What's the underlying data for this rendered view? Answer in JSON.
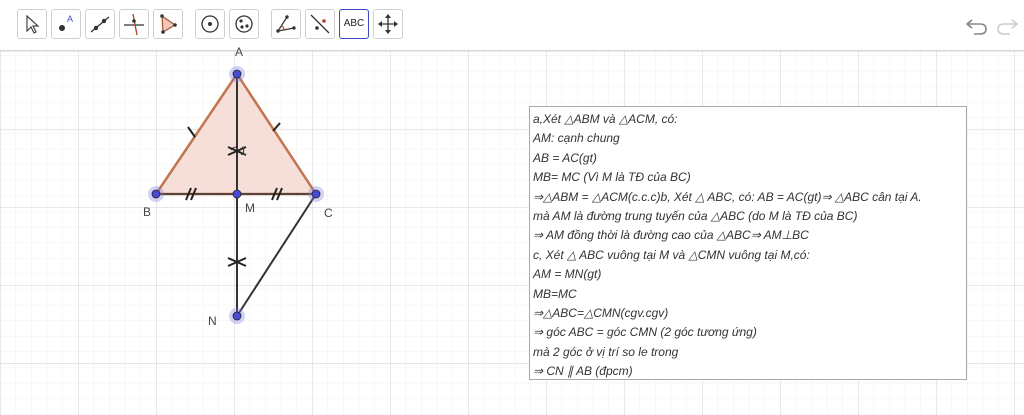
{
  "toolbar": {
    "tools": [
      {
        "name": "move",
        "icon": "cursor-arrow-icon"
      },
      {
        "name": "point",
        "icon": "point-icon",
        "label": "A"
      },
      {
        "name": "line",
        "icon": "line-icon"
      },
      {
        "name": "perpendicular",
        "icon": "perpendicular-line-icon"
      },
      {
        "name": "polygon",
        "icon": "polygon-icon"
      },
      {
        "name": "circle",
        "icon": "circle-center-icon"
      },
      {
        "name": "circle-three-points",
        "icon": "circle-three-points-icon"
      },
      {
        "name": "angle",
        "icon": "angle-icon"
      },
      {
        "name": "reflect",
        "icon": "reflect-icon"
      },
      {
        "name": "text",
        "icon": "text-icon",
        "label": "ABC"
      },
      {
        "name": "move-view",
        "icon": "move-graphics-icon"
      }
    ],
    "undo_icon": "undo-icon",
    "redo_icon": "redo-icon"
  },
  "geometry": {
    "points": {
      "A": "A",
      "B": "B",
      "C": "C",
      "M": "M",
      "N": "N"
    },
    "angle_label": "1",
    "colors": {
      "triangle_fill": "#f5dcd4",
      "triangle_stroke": "#c0754f",
      "point_fill": "#4a4ad6",
      "segment": "#333333"
    }
  },
  "text_lines": [
    "a,Xét △ABM và △ACM, có:",
    "  AM: cạnh chung",
    "  AB = AC(gt)",
    "    MB= MC (Vì M là TĐ của BC)",
    "⇒△ABM = △ACM(c.c.c)b, Xét △ ABC, có:    AB = AC(gt)⇒ △ABC cân tại A.",
    "mà AM là đường trung tuyến của △ABC (do M là TĐ của BC)",
    "⇒ AM đồng thời là đường cao của △ABC⇒ AM⊥BC",
    "c, Xét △ ABC vuông tại M và △CMN vuông tại M,có:",
    "  AM = MN(gt)",
    "  MB=MC",
    "⇒△ABC=△CMN(cgv.cgv)",
    "⇒ góc ABC = góc CMN (2 góc tương ứng)",
    "mà 2 góc ở vị trí so le trong",
    "⇒ CN ∥ AB (đpcm)"
  ]
}
